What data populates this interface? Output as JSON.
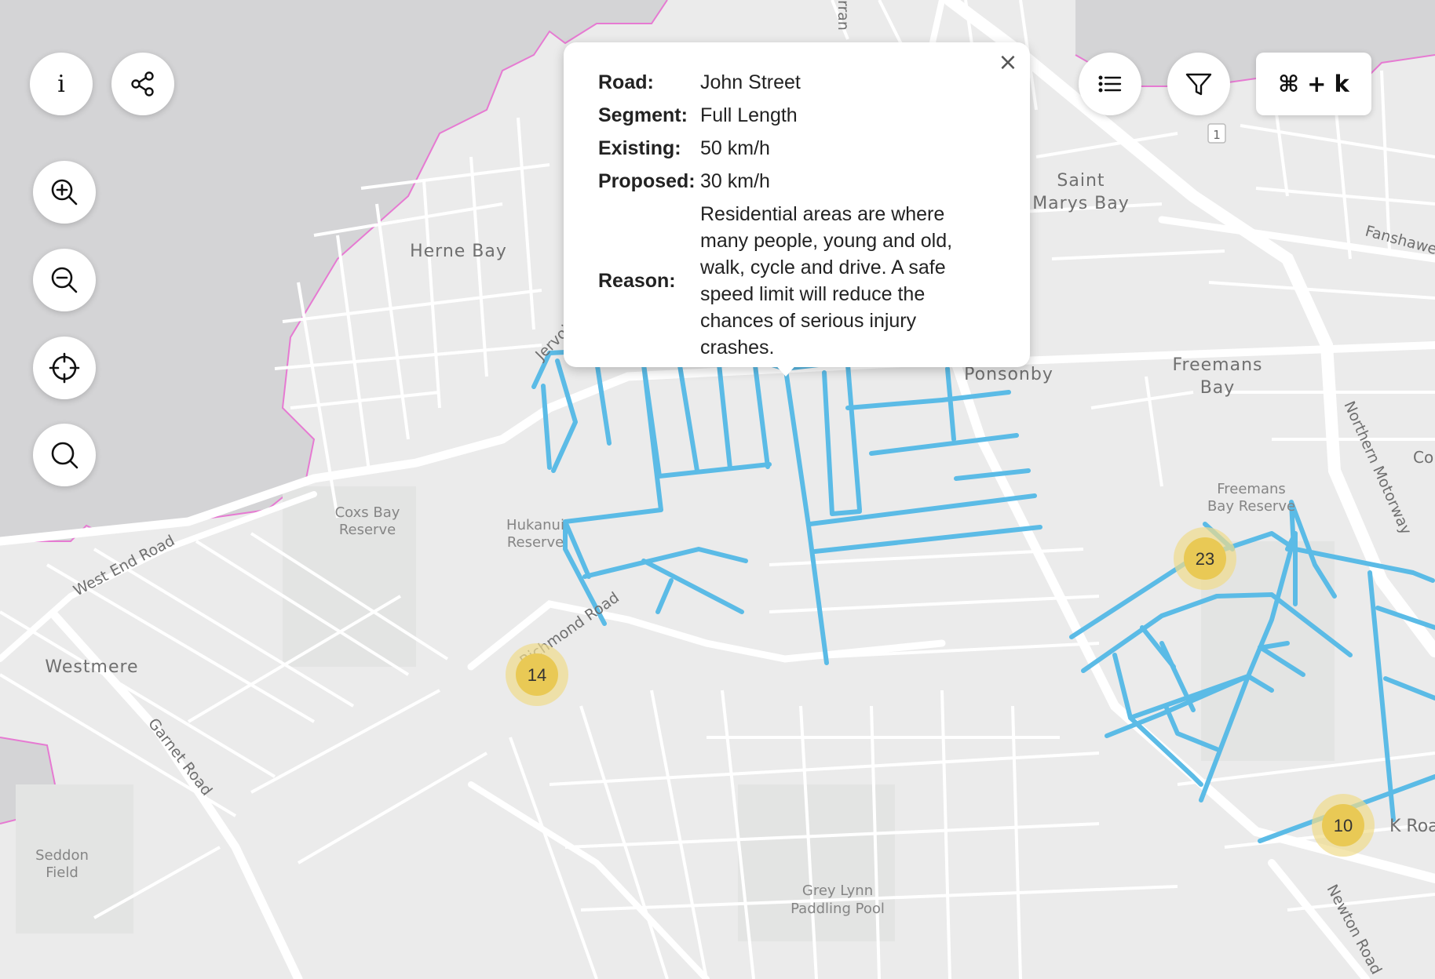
{
  "map_labels": {
    "herne_bay": "Herne Bay",
    "saint_marys_bay_1": "Saint",
    "saint_marys_bay_2": "Marys Bay",
    "freemans_bay_1": "Freemans",
    "freemans_bay_2": "Bay",
    "freemans_bay_reserve_1": "Freemans",
    "freemans_bay_reserve_2": "Bay Reserve",
    "ponsonby": "Ponsonby",
    "coxs_bay_reserve_1": "Coxs Bay",
    "coxs_bay_reserve_2": "Reserve",
    "hukanui_reserve_1": "Hukanui",
    "hukanui_reserve_2": "Reserve",
    "westmere": "Westmere",
    "west_end_road": "West End Road",
    "garnet_road": "Garnet Road",
    "richmond_road": "Richmond Road",
    "jervois": "Jervois",
    "seddon_field_1": "Seddon",
    "seddon_field_2": "Field",
    "grey_lynn_paddling_pool_1": "Grey Lynn",
    "grey_lynn_paddling_pool_2": "Paddling Pool",
    "northern_motorway": "Northern Motorway",
    "newton_road": "Newton Road",
    "fanshawe": "Fanshawe",
    "k_road": "K Road",
    "edge_top": "rran",
    "edge_right": "Co",
    "route_shield": "1"
  },
  "clusters": [
    {
      "label": "14"
    },
    {
      "label": "23"
    },
    {
      "label": "10"
    }
  ],
  "controls": {
    "info_glyph": "i",
    "shortcut_label": "⌘ + k"
  },
  "popup": {
    "close_glyph": "×",
    "road_key": "Road:",
    "road_value": "John Street",
    "segment_key": "Segment:",
    "segment_value": "Full Length",
    "existing_key": "Existing:",
    "existing_value": "50 km/h",
    "proposed_key": "Proposed:",
    "proposed_value": "30 km/h",
    "reason_key": "Reason:",
    "reason_value": "Residential areas are where many people, young and old, walk, cycle and drive. A safe speed limit will reduce the chances of serious injury crashes."
  },
  "colors": {
    "water": "#d4d4d6",
    "land": "#ebebeb",
    "road": "#ffffff",
    "coast_boundary": "#e67ad2",
    "speed_route": "#5bbbe6",
    "cluster_fill": "#e9c955",
    "cluster_halo": "#efdc8c"
  }
}
